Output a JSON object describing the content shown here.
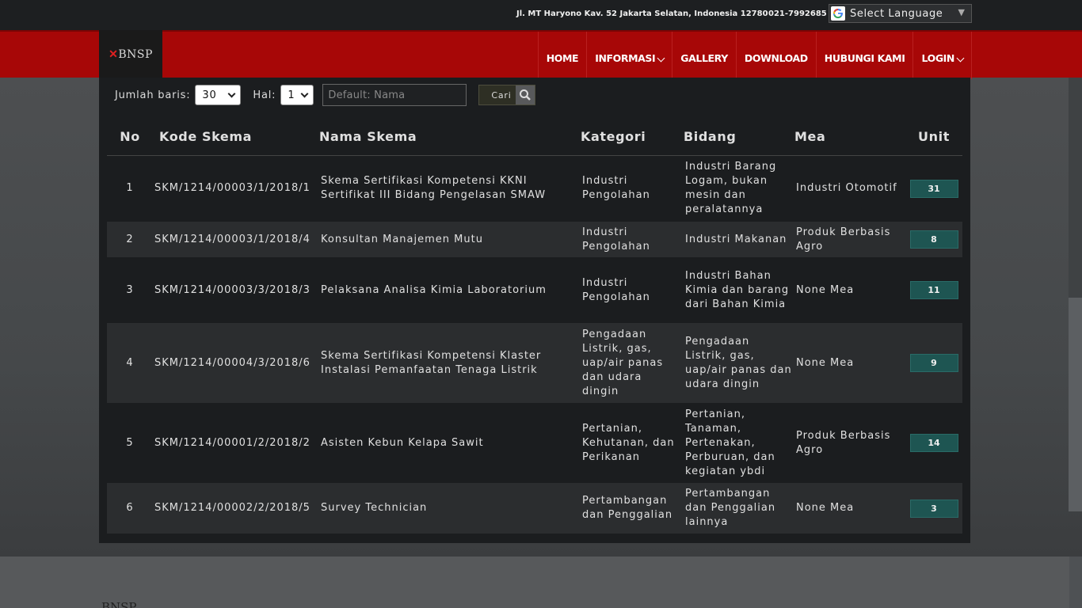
{
  "topbar": {
    "address": "Jl. MT Haryono Kav. 52 Jakarta Selatan, Indonesia 12780",
    "phone": "021-7992685",
    "language_label": "Select Language"
  },
  "logo_text": "BNSP",
  "nav": {
    "home": "HOME",
    "informasi": "INFORMASI",
    "gallery": "GALLERY",
    "download": "DOWNLOAD",
    "hubungi": "HUBUNGI KAMI",
    "login": "LOGIN"
  },
  "controls": {
    "rows_label": "Jumlah baris:",
    "rows_value": "30",
    "page_label": "Hal:",
    "page_value": "1",
    "search_placeholder": "Default: Nama",
    "search_button": "Cari"
  },
  "table": {
    "headers": {
      "no": "No",
      "kode": "Kode Skema",
      "nama": "Nama Skema",
      "kategori": "Kategori",
      "bidang": "Bidang",
      "mea": "Mea",
      "unit": "Unit"
    },
    "rows": [
      {
        "no": "1",
        "kode": "SKM/1214/00003/1/2018/1",
        "nama": "Skema Sertifikasi Kompetensi KKNI Sertifikat III Bidang Pengelasan SMAW",
        "kategori": "Industri Pengolahan",
        "bidang": "Industri Barang Logam, bukan mesin dan peralatannya",
        "mea": "Industri Otomotif",
        "unit": "31"
      },
      {
        "no": "2",
        "kode": "SKM/1214/00003/1/2018/4",
        "nama": "Konsultan Manajemen Mutu",
        "kategori": "Industri Pengolahan",
        "bidang": "Industri Makanan",
        "mea": "Produk Berbasis Agro",
        "unit": "8"
      },
      {
        "no": "3",
        "kode": "SKM/1214/00003/3/2018/3",
        "nama": "Pelaksana Analisa Kimia Laboratorium",
        "kategori": "Industri Pengolahan",
        "bidang": "Industri Bahan Kimia dan barang dari Bahan Kimia",
        "mea": "None Mea",
        "unit": "11"
      },
      {
        "no": "4",
        "kode": "SKM/1214/00004/3/2018/6",
        "nama": "Skema Sertifikasi Kompetensi Klaster Instalasi Pemanfaatan Tenaga Listrik",
        "kategori": "Pengadaan Listrik, gas, uap/air panas dan udara dingin",
        "bidang": "Pengadaan Listrik, gas, uap/air panas dan udara dingin",
        "mea": "None Mea",
        "unit": "9"
      },
      {
        "no": "5",
        "kode": "SKM/1214/00001/2/2018/2",
        "nama": "Asisten Kebun Kelapa Sawit",
        "kategori": "Pertanian, Kehutanan, dan Perikanan",
        "bidang": "Pertanian, Tanaman, Pertenakan, Perburuan, dan kegiatan ybdi",
        "mea": "Produk Berbasis Agro",
        "unit": "14"
      },
      {
        "no": "6",
        "kode": "SKM/1214/00002/2/2018/5",
        "nama": "Survey Technician",
        "kategori": "Pertambangan dan Penggalian",
        "bidang": "Pertambangan dan Penggalian lainnya",
        "mea": "None Mea",
        "unit": "3"
      }
    ]
  },
  "footer_logo": "BNSP"
}
